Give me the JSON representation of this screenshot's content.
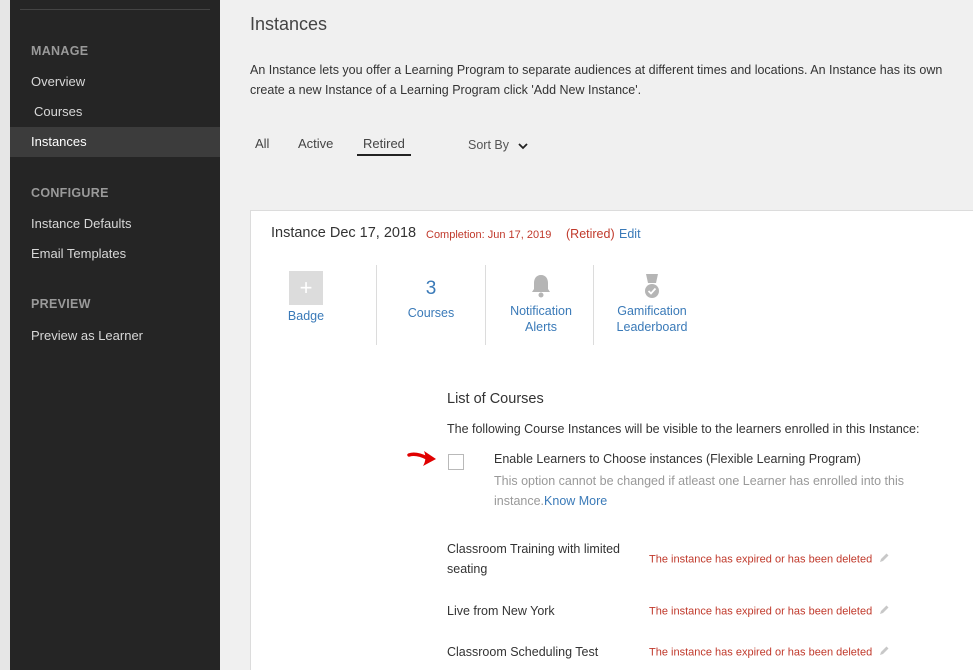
{
  "sidebar": {
    "sections": [
      {
        "heading": "MANAGE",
        "items": [
          "Overview",
          "Courses",
          "Instances"
        ]
      },
      {
        "heading": "CONFIGURE",
        "items": [
          "Instance Defaults",
          "Email Templates"
        ]
      },
      {
        "heading": "PREVIEW",
        "items": [
          "Preview as Learner"
        ]
      }
    ],
    "active_item": "Instances"
  },
  "page": {
    "title": "Instances",
    "description_line1": "An Instance lets you offer a Learning Program to separate audiences at different times and locations. An Instance has its own",
    "description_line2": "create a new Instance of a Learning Program click 'Add New Instance'."
  },
  "tabs": {
    "all": "All",
    "active": "Active",
    "retired": "Retired",
    "selected": "Retired"
  },
  "sort": {
    "label": "Sort By"
  },
  "instance": {
    "title": "Instance Dec 17, 2018",
    "completion": "Completion: Jun 17, 2019",
    "retired": "(Retired)",
    "edit": "Edit",
    "stats": {
      "badge_label": "Badge",
      "badge_plus": "+",
      "courses_count": "3",
      "courses_label": "Courses",
      "notification_line1": "Notification",
      "notification_line2": "Alerts",
      "gamification_line1": "Gamification",
      "gamification_line2": "Leaderboard"
    }
  },
  "list_of_courses": {
    "title": "List of Courses",
    "description": "The following Course Instances will be visible to the learners enrolled in this Instance:",
    "flexible_label": "Enable Learners to Choose instances (Flexible Learning Program)",
    "flexible_note": "This option cannot be changed if atleast one Learner has enrolled into this instance.",
    "know_more": "Know More",
    "flexible_checked": false,
    "courses": [
      {
        "name": "Classroom Training with limited seating",
        "status": "The instance has expired or has been deleted"
      },
      {
        "name": "Live from New York",
        "status": "The instance has expired or has been deleted"
      },
      {
        "name": "Classroom Scheduling Test",
        "status": "The instance has expired or has been deleted"
      }
    ]
  },
  "colors": {
    "accent": "#3a7ab8",
    "error": "#c0392b",
    "sidebar_bg": "#252525",
    "annotation_arrow": "#e00000"
  }
}
